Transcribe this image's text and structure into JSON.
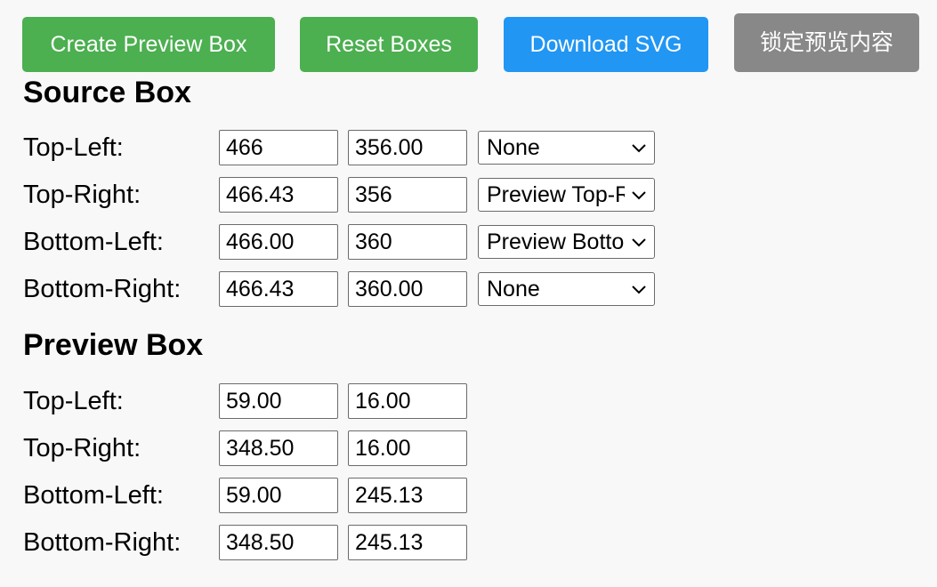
{
  "toolbar": {
    "create_preview_label": "Create Preview Box",
    "reset_label": "Reset Boxes",
    "download_label": "Download SVG",
    "lock_label": "锁定预览内容"
  },
  "colors": {
    "green_button": "#4caf50",
    "blue_button": "#2196f3",
    "gray_button": "#888888",
    "background": "#f8f8f8"
  },
  "source_box": {
    "title": "Source Box",
    "rows": [
      {
        "label": "Top-Left:",
        "x": "466",
        "y": "356.00",
        "mapping": "None"
      },
      {
        "label": "Top-Right:",
        "x": "466.43",
        "y": "356",
        "mapping": "Preview Top-Right"
      },
      {
        "label": "Bottom-Left:",
        "x": "466.00",
        "y": "360",
        "mapping": "Preview Bottom-Left"
      },
      {
        "label": "Bottom-Right:",
        "x": "466.43",
        "y": "360.00",
        "mapping": "None"
      }
    ]
  },
  "preview_box": {
    "title": "Preview Box",
    "rows": [
      {
        "label": "Top-Left:",
        "x": "59.00",
        "y": "16.00"
      },
      {
        "label": "Top-Right:",
        "x": "348.50",
        "y": "16.00"
      },
      {
        "label": "Bottom-Left:",
        "x": "59.00",
        "y": "245.13"
      },
      {
        "label": "Bottom-Right:",
        "x": "348.50",
        "y": "245.13"
      }
    ]
  }
}
